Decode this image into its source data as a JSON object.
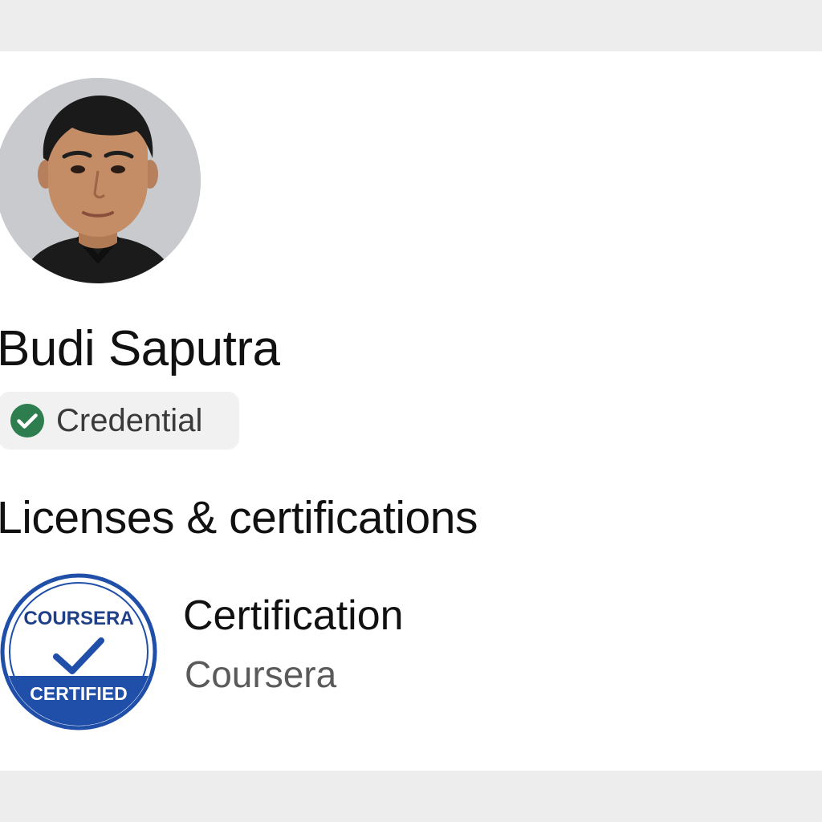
{
  "profile": {
    "name": "Budi Saputra",
    "avatar_icon": "profile-photo",
    "credential_label": "Credential",
    "credential_icon": "check-circle-icon",
    "credential_color": "#2e7d4f"
  },
  "section": {
    "title": "Licenses & certifications"
  },
  "certifications": [
    {
      "title": "Certification",
      "issuer": "Coursera",
      "logo": {
        "top_text": "COURSERA",
        "bottom_text": "CERTIFIED",
        "brand_color": "#1f4fa8",
        "icon": "coursera-certified-badge"
      }
    }
  ],
  "colors": {
    "page_background": "#ededed",
    "card_background": "#ffffff",
    "text_primary": "#111111",
    "text_secondary": "#5a5a5a"
  }
}
